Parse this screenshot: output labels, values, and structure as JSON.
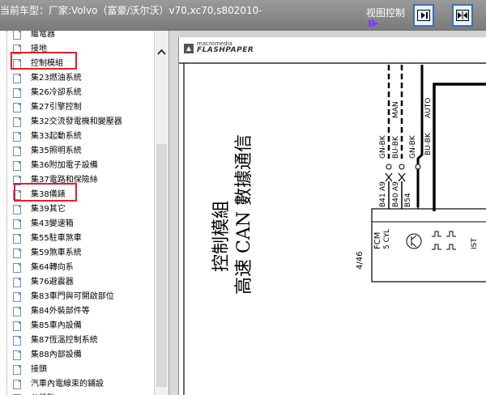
{
  "window": {
    "title": "当前车型：厂家:Volvo（富豪/沃尔沃）v70,xc70,s802010-",
    "view_control_label": "视图控制"
  },
  "toolbar": {
    "buttons": [
      {
        "name": "fit-width-button",
        "icon": "fit-width-icon"
      },
      {
        "name": "fit-page-button",
        "icon": "fit-page-icon"
      }
    ]
  },
  "tree": {
    "items": [
      {
        "label": "繼電器"
      },
      {
        "label": "接地"
      },
      {
        "label": "控制模組",
        "highlighted": true
      },
      {
        "label": "集23燃油系統"
      },
      {
        "label": "集26冷卻系統"
      },
      {
        "label": "集27引擎控制"
      },
      {
        "label": "集32交流發電機和變壓器"
      },
      {
        "label": "集33起動系統"
      },
      {
        "label": "集35照明系統"
      },
      {
        "label": "集36附加電子設備"
      },
      {
        "label": "集37電路和保險絲"
      },
      {
        "label": "集38儀錶",
        "highlighted": true
      },
      {
        "label": "集39其它"
      },
      {
        "label": "集43變速箱"
      },
      {
        "label": "集55駐車煞車"
      },
      {
        "label": "集59煞車系統"
      },
      {
        "label": "集64轉向系"
      },
      {
        "label": "集76避震器"
      },
      {
        "label": "集83車門與可開啟部位"
      },
      {
        "label": "集84外裝部件等"
      },
      {
        "label": "集85車內設備"
      },
      {
        "label": "集87恆溫控制系統"
      },
      {
        "label": "集88內部設備"
      },
      {
        "label": "接頭"
      },
      {
        "label": "汽車內電線束的鋪設"
      },
      {
        "label": "分段點"
      }
    ]
  },
  "viewer": {
    "brand_small": "macromedia",
    "brand_big": "FLASHPAPER",
    "title_line1": "控制模組",
    "title_line2": "高速 CAN 數據通信",
    "page_number": "4/46",
    "module_label": "FCM",
    "module_sub": "5 CYL",
    "wire_labels": [
      "GN-BK",
      "BU-BK",
      "GN-BK",
      "BU-BK"
    ],
    "mode_labels": [
      "MAN",
      "AUTO"
    ],
    "pins": [
      "A9",
      "A9",
      "B41",
      "B40",
      "B54"
    ],
    "signal_label": "IST"
  },
  "colors": {
    "titlebar": "#8a8a8a",
    "highlight": "#e0202a",
    "button_border": "#3b6fb6"
  }
}
